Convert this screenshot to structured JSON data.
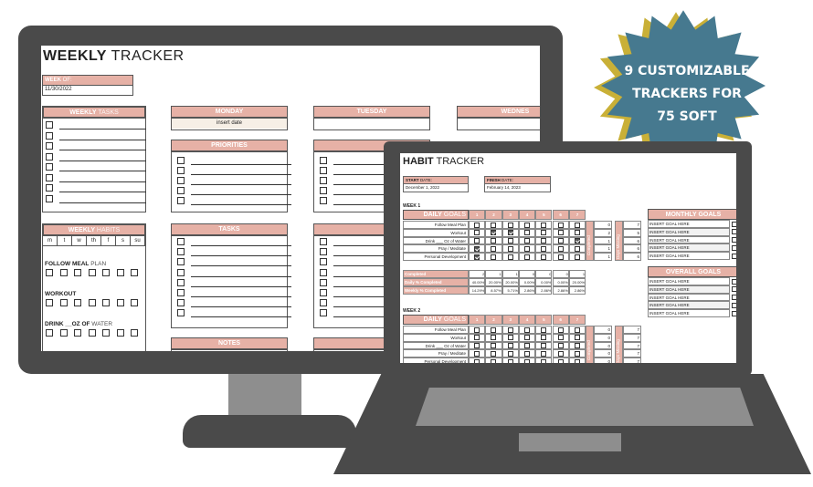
{
  "badge": {
    "lines": [
      "9 CUSTOMIZABLE",
      "TRACKERS FOR",
      "75 SOFT"
    ],
    "fill": "#46798f",
    "shadow": "#c9b037"
  },
  "colors": {
    "header": "#e6b1a6",
    "device": "#4a4a4a",
    "keyboard": "#8e8e8e"
  },
  "weekly": {
    "title_bold": "WEEKLY",
    "title_light": "TRACKER",
    "week_of_bold": "WEEK",
    "week_of_light": "OF:",
    "week_of_value": "11/30/2022",
    "tasks_bold": "WEEKLY",
    "tasks_light": "TASKS",
    "habits_bold": "WEEKLY",
    "habits_light": "HABITS",
    "days": [
      "MONDAY",
      "TUESDAY",
      "WEDNES"
    ],
    "date_placeholder": "insert date",
    "priorities": "PRIORITIES",
    "priorities_clipped": "PRIORI",
    "tasks": "TASKS",
    "tasks_clipped": "TASK",
    "notes": "NOTES",
    "notes_clipped": "NOTI",
    "weekdays": [
      "m",
      "t",
      "w",
      "th",
      "f",
      "s",
      "su"
    ],
    "habits": [
      {
        "bold": "FOLLOW MEAL",
        "light": "PLAN"
      },
      {
        "bold": "WORKOUT",
        "light": ""
      },
      {
        "bold": "DRINK __OZ OF",
        "light": "WATER"
      }
    ]
  },
  "habit": {
    "title_bold": "HABIT",
    "title_light": "TRACKER",
    "start_bold": "START",
    "start_light": "DATE:",
    "start_value": "December 1, 2022",
    "finish_bold": "FINISH",
    "finish_light": "DATE:",
    "finish_value": "February 14, 2023",
    "daily_bold": "DAILY",
    "daily_light": "GOALS",
    "day_numbers": [
      "1",
      "2",
      "3",
      "4",
      "5",
      "6",
      "7"
    ],
    "completed_label": "Completed",
    "days_missing_label": "Days Missing",
    "weeks": [
      {
        "label": "WEEK 1",
        "goals": [
          {
            "name": "Follow Meal Plan",
            "checks": [
              0,
              0,
              0,
              0,
              0,
              0,
              0
            ],
            "completed": 0,
            "missing": 7
          },
          {
            "name": "Workout",
            "checks": [
              0,
              1,
              1,
              0,
              0,
              0,
              0
            ],
            "completed": 2,
            "missing": 5
          },
          {
            "name": "Drink ___ Oz of Water",
            "checks": [
              0,
              0,
              0,
              0,
              0,
              0,
              1
            ],
            "completed": 1,
            "missing": 6
          },
          {
            "name": "Pray / Meditate",
            "checks": [
              1,
              0,
              0,
              0,
              0,
              0,
              0
            ],
            "completed": 1,
            "missing": 6
          },
          {
            "name": "Personal Development",
            "checks": [
              1,
              0,
              0,
              0,
              0,
              0,
              0
            ],
            "completed": 1,
            "missing": 6
          }
        ],
        "summary": {
          "completed_label": "Completed",
          "completed": [
            "2",
            "1",
            "1",
            "0",
            "0",
            "0",
            "1"
          ],
          "daily_label": "Daily % Completed",
          "daily": [
            "40.00%",
            "20.00%",
            "20.00%",
            "0.00%",
            "0.00%",
            "0.00%",
            "20.00%"
          ],
          "weekly_label": "Weekly % Completed",
          "weekly": [
            "14.29%",
            "8.57%",
            "5.71%",
            "2.86%",
            "2.86%",
            "2.86%",
            "2.86%"
          ]
        }
      },
      {
        "label": "WEEK 2",
        "goals": [
          {
            "name": "Follow Meal Plan",
            "checks": [
              0,
              0,
              0,
              0,
              0,
              0,
              0
            ],
            "completed": 0,
            "missing": 7
          },
          {
            "name": "Workout",
            "checks": [
              0,
              0,
              0,
              0,
              0,
              0,
              0
            ],
            "completed": 0,
            "missing": 7
          },
          {
            "name": "Drink ___ Oz of Water",
            "checks": [
              0,
              0,
              0,
              0,
              0,
              0,
              0
            ],
            "completed": 0,
            "missing": 7
          },
          {
            "name": "Pray / Meditate",
            "checks": [
              0,
              0,
              0,
              0,
              0,
              0,
              0
            ],
            "completed": 0,
            "missing": 7
          },
          {
            "name": "Personal Development",
            "checks": [
              0,
              0,
              0,
              0,
              0,
              0,
              0
            ],
            "completed": 0,
            "missing": 7
          }
        ]
      }
    ],
    "monthly_goals": {
      "title": "MONTHLY GOALS",
      "items": [
        "INSERT GOAL HERE",
        "INSERT GOAL HERE",
        "INSERT GOAL HERE",
        "INSERT GOAL HERE",
        "INSERT GOAL HERE"
      ]
    },
    "overall_goals": {
      "title": "OVERALL GOALS",
      "items": [
        "INSERT GOAL HERE",
        "INSERT GOAL HERE",
        "INSERT GOAL HERE",
        "INSERT GOAL HERE",
        "INSERT GOAL HERE"
      ]
    }
  }
}
